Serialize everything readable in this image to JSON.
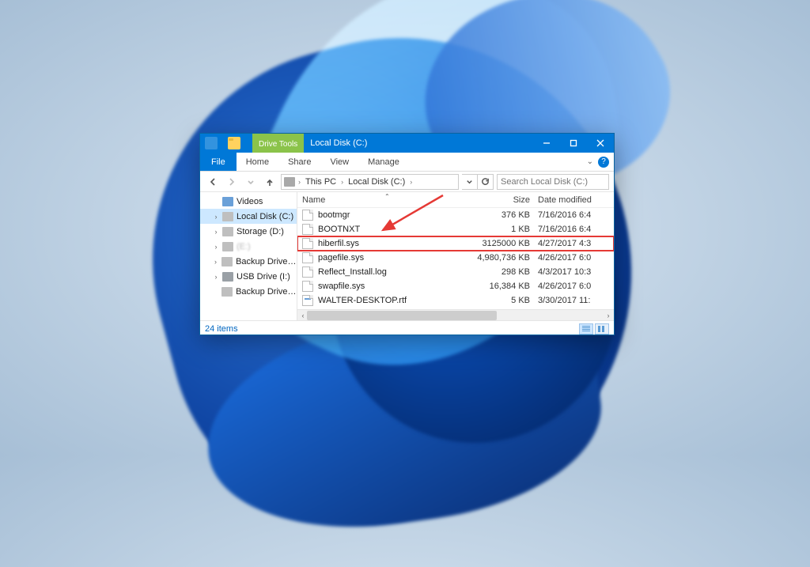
{
  "titlebar": {
    "context_tab": "Drive Tools",
    "title": "Local Disk (C:)"
  },
  "ribbon": {
    "file": "File",
    "tabs": [
      "Home",
      "Share",
      "View",
      "Manage"
    ]
  },
  "address": {
    "segments": [
      "This PC",
      "Local Disk (C:)"
    ],
    "search_placeholder": "Search Local Disk (C:)"
  },
  "nav_pane": [
    {
      "label": "Videos",
      "icon": "vid",
      "expandable": false
    },
    {
      "label": "Local Disk (C:)",
      "icon": "drive",
      "expandable": true,
      "selected": true
    },
    {
      "label": "Storage (D:)",
      "icon": "drive",
      "expandable": true
    },
    {
      "label": "(E:)",
      "icon": "drive",
      "expandable": true,
      "dimmed": true
    },
    {
      "label": "Backup Drive (H:)",
      "icon": "drive",
      "expandable": true
    },
    {
      "label": "USB Drive (I:)",
      "icon": "usb",
      "expandable": true
    },
    {
      "label": "Backup Drive (H:)",
      "icon": "drive",
      "expandable": false
    }
  ],
  "columns": {
    "name": "Name",
    "size": "Size",
    "date": "Date modified"
  },
  "files": [
    {
      "name": "bootmgr",
      "size": "376 KB",
      "date": "7/16/2016 6:4",
      "icon": "file"
    },
    {
      "name": "BOOTNXT",
      "size": "1 KB",
      "date": "7/16/2016 6:4",
      "icon": "file"
    },
    {
      "name": "hiberfil.sys",
      "size": "3125000 KB",
      "date": "4/27/2017 4:3",
      "icon": "file",
      "highlight": true
    },
    {
      "name": "pagefile.sys",
      "size": "4,980,736 KB",
      "date": "4/26/2017 6:0",
      "icon": "file"
    },
    {
      "name": "Reflect_Install.log",
      "size": "298 KB",
      "date": "4/3/2017 10:3",
      "icon": "file"
    },
    {
      "name": "swapfile.sys",
      "size": "16,384 KB",
      "date": "4/26/2017 6:0",
      "icon": "file"
    },
    {
      "name": "WALTER-DESKTOP.rtf",
      "size": "5 KB",
      "date": "3/30/2017 11:",
      "icon": "app"
    }
  ],
  "status": {
    "item_count": "24 items"
  }
}
